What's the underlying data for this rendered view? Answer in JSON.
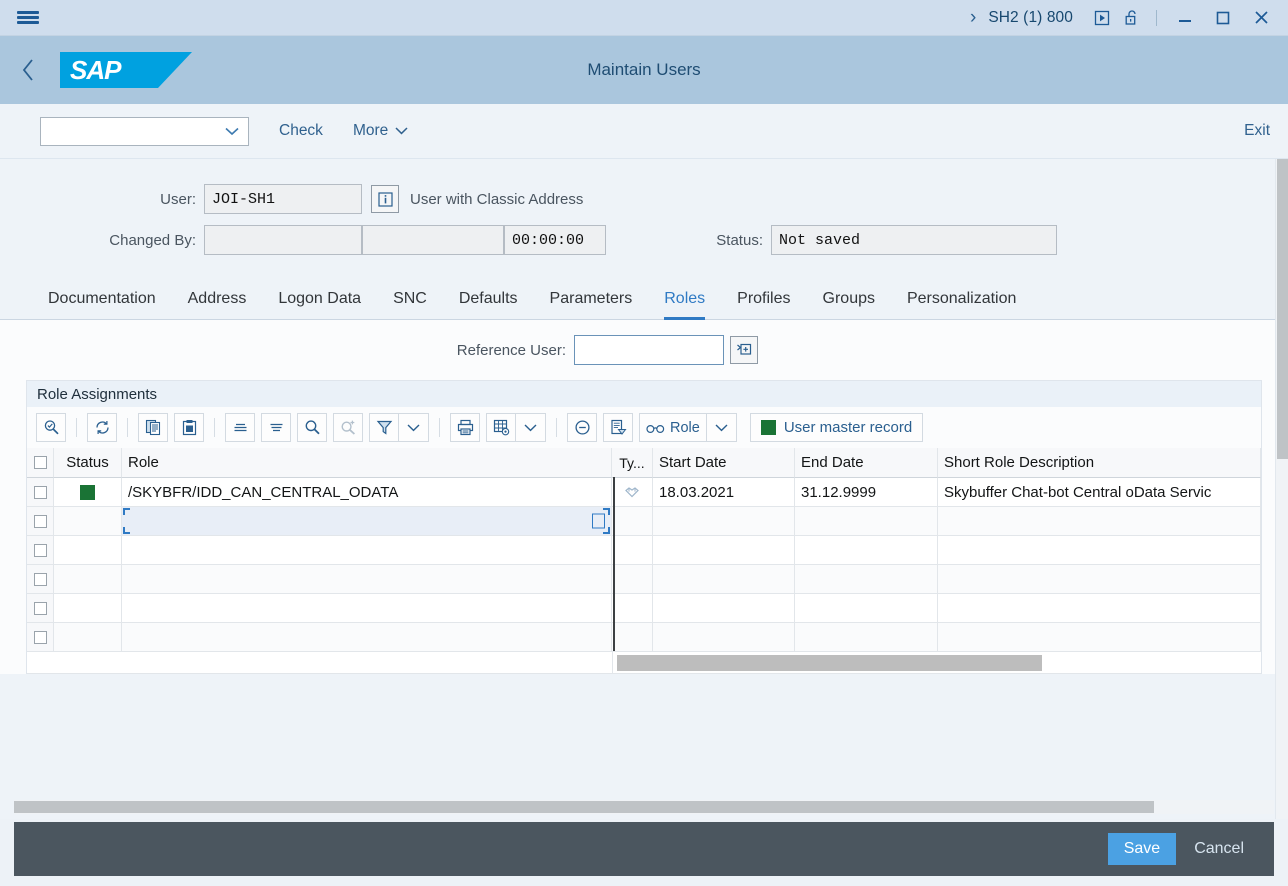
{
  "titlebar": {
    "menu_icon": "hamburger-menu-icon",
    "chevron_icon": "chevron-right-icon",
    "system": "SH2 (1) 800",
    "play_icon": "play-in-box-icon",
    "lock_icon": "unlocked-padlock-icon",
    "minimize_icon": "minimize-icon",
    "maximize_icon": "maximize-icon",
    "close_icon": "close-icon"
  },
  "shell": {
    "back_icon": "back-chevron-icon",
    "logo": "SAP",
    "title": "Maintain Users"
  },
  "toolbar": {
    "combo_value": "",
    "combo_placeholder": "",
    "check_label": "Check",
    "more_label": "More",
    "exit_label": "Exit"
  },
  "form": {
    "user_label": "User:",
    "user_value": "JOI-SH1",
    "user_info_icon": "info-icon",
    "user_hint": "User with Classic Address",
    "changed_by_label": "Changed By:",
    "changed_by_value": "",
    "changed_date_value": "",
    "changed_time_value": "00:00:00",
    "status_label": "Status:",
    "status_value": "Not saved"
  },
  "tabs": [
    {
      "label": "Documentation",
      "selected": false
    },
    {
      "label": "Address",
      "selected": false
    },
    {
      "label": "Logon Data",
      "selected": false
    },
    {
      "label": "SNC",
      "selected": false
    },
    {
      "label": "Defaults",
      "selected": false
    },
    {
      "label": "Parameters",
      "selected": false
    },
    {
      "label": "Roles",
      "selected": true
    },
    {
      "label": "Profiles",
      "selected": false
    },
    {
      "label": "Groups",
      "selected": false
    },
    {
      "label": "Personalization",
      "selected": false
    }
  ],
  "reference": {
    "label": "Reference User:",
    "value": "",
    "help_icon": "value-help-icon"
  },
  "table": {
    "title": "Role Assignments",
    "toolbar_buttons": [
      {
        "name": "search-detail-icon",
        "label": ""
      },
      {
        "name": "refresh-icon",
        "label": ""
      },
      {
        "name": "copy-icon",
        "label": ""
      },
      {
        "name": "paste-icon",
        "label": ""
      },
      {
        "name": "sort-ascending-icon",
        "label": ""
      },
      {
        "name": "sort-descending-icon",
        "label": ""
      },
      {
        "name": "find-icon",
        "label": ""
      },
      {
        "name": "find-next-icon",
        "label": ""
      },
      {
        "name": "filter-icon",
        "label": ""
      },
      {
        "name": "print-icon",
        "label": ""
      },
      {
        "name": "table-settings-icon",
        "label": ""
      },
      {
        "name": "delete-row-icon",
        "label": ""
      },
      {
        "name": "documentation-icon",
        "label": ""
      },
      {
        "name": "role-glasses-icon",
        "label": "Role"
      }
    ],
    "user_master_record": {
      "label": "User master record",
      "status_color": "#1a7335"
    },
    "columns": [
      {
        "key": "select",
        "label": ""
      },
      {
        "key": "status",
        "label": "Status"
      },
      {
        "key": "role",
        "label": "Role"
      },
      {
        "key": "type",
        "label": "Ty..."
      },
      {
        "key": "start_date",
        "label": "Start Date"
      },
      {
        "key": "end_date",
        "label": "End Date"
      },
      {
        "key": "description",
        "label": "Short Role Description"
      }
    ],
    "rows": [
      {
        "status_color": "#1a7335",
        "role": "/SKYBFR/IDD_CAN_CENTRAL_ODATA",
        "type_icon": "role-handshake-icon",
        "start_date": "18.03.2021",
        "end_date": "31.12.9999",
        "description": "Skybuffer Chat-bot Central oData Servic",
        "selected": false
      },
      {
        "status_color": "",
        "role": "",
        "type_icon": "",
        "start_date": "",
        "end_date": "",
        "description": "",
        "selected": true
      },
      {
        "status_color": "",
        "role": "",
        "type_icon": "",
        "start_date": "",
        "end_date": "",
        "description": "",
        "selected": false
      },
      {
        "status_color": "",
        "role": "",
        "type_icon": "",
        "start_date": "",
        "end_date": "",
        "description": "",
        "selected": false
      },
      {
        "status_color": "",
        "role": "",
        "type_icon": "",
        "start_date": "",
        "end_date": "",
        "description": "",
        "selected": false
      },
      {
        "status_color": "",
        "role": "",
        "type_icon": "",
        "start_date": "",
        "end_date": "",
        "description": "",
        "selected": false
      }
    ]
  },
  "footer": {
    "save_label": "Save",
    "cancel_label": "Cancel",
    "save_color": "#4ba1e3"
  }
}
